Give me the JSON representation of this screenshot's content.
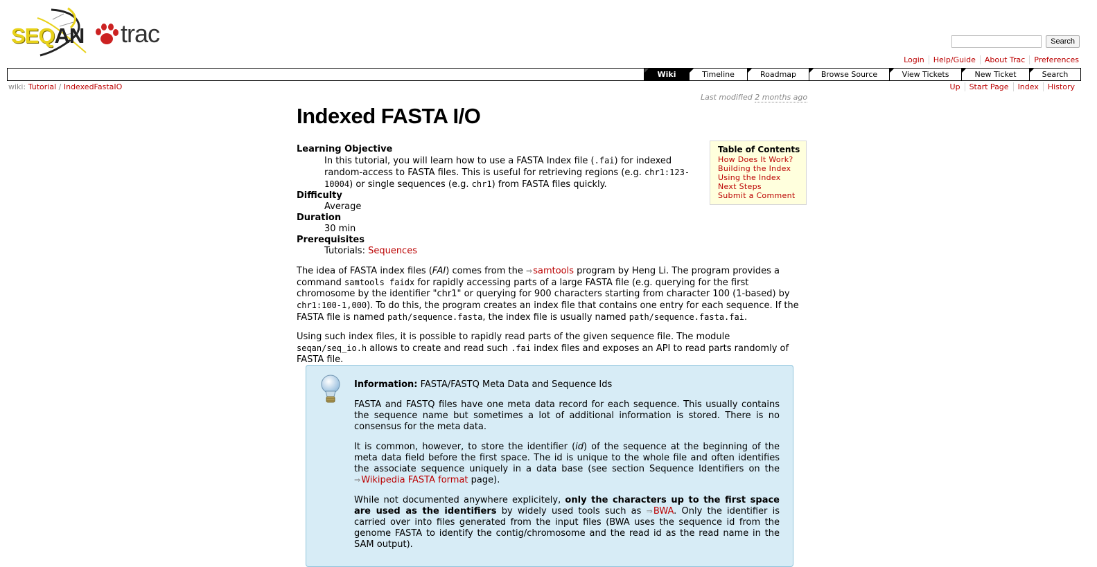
{
  "logo": {
    "seqan_a": "SEQ",
    "seqan_b": "AN",
    "trac": "trac"
  },
  "search": {
    "button": "Search",
    "placeholder": ""
  },
  "metanav": [
    "Login",
    "Help/Guide",
    "About Trac",
    "Preferences"
  ],
  "mainnav": [
    "Wiki",
    "Timeline",
    "Roadmap",
    "Browse Source",
    "View Tickets",
    "New Ticket",
    "Search"
  ],
  "breadcrumb": {
    "prefix": "wiki:",
    "parent": "Tutorial",
    "sep": "/",
    "page": "IndexedFastaIO"
  },
  "ctxtnav": [
    "Up",
    "Start Page",
    "Index",
    "History"
  ],
  "lastmod": {
    "prefix": "Last modified",
    "ago": "2 months ago"
  },
  "page": {
    "title": "Indexed FASTA I/O",
    "objective_label": "Learning Objective",
    "objective": {
      "t1": "In this tutorial, you will learn how to use a FASTA Index file (",
      "c1": ".fai",
      "t2": ") for indexed random-access to FASTA files. This is useful for retrieving regions (e.g. ",
      "c2": "chr1:123-10004",
      "t3": ") or single sequences (e.g. ",
      "c3": "chr1",
      "t4": ") from FASTA files quickly."
    },
    "difficulty_label": "Difficulty",
    "difficulty": "Average",
    "duration_label": "Duration",
    "duration": "30 min",
    "prereq_label": "Prerequisites",
    "prereq_text": "Tutorials: ",
    "prereq_link": "Sequences",
    "para1": {
      "t1": "The idea of FASTA index files (",
      "i1": "FAI",
      "t2": ") comes from the ",
      "link": "samtools",
      "t3": " program by Heng Li. The program provides a command ",
      "c1": "samtools faidx",
      "t4": " for rapidly accessing parts of a large FASTA file (e.g. querying for the first chromosome by the identifier \"chr1\" or querying for 900 characters starting from character 100 (1-based) by ",
      "c2": "chr1:100-1,000",
      "t5": "). To do this, the program creates an index file that contains one entry for each sequence. If the FASTA file is named ",
      "c3": "path/sequence.fasta",
      "t6": ", the index file is usually named ",
      "c4": "path/sequence.fasta.fai",
      "t7": "."
    },
    "para2": {
      "t1": "Using such index files, it is possible to rapidly read parts of the given sequence file. The module ",
      "c1": "seqan/seq_io.h",
      "t2": " allows to create and read such ",
      "c2": ".fai",
      "t3": " index files and exposes an API to read parts randomly of FASTA file."
    }
  },
  "toc": {
    "title": "Table of Contents",
    "items": [
      "How Does It Work?",
      "Building the Index",
      "Using the Index",
      "Next Steps",
      "Submit a Comment"
    ]
  },
  "info": {
    "label": "Information:",
    "title": "FASTA/FASTQ Meta Data and Sequence Ids",
    "p1": "FASTA and FASTQ files have one meta data record for each sequence. This usually contains the sequence name but sometimes a lot of additional information is stored. There is no consensus for the meta data.",
    "p2": {
      "t1": "It is common, however, to store the identifier (",
      "i1": "id",
      "t2": ") of the sequence at the beginning of the meta data field before the first space. The id is unique to the whole file and often identifies the associate sequence uniquely in a data base (see section Sequence Identifiers on the ",
      "link": "Wikipedia FASTA format",
      "t3": " page)."
    },
    "p3": {
      "t1": "While not documented anywhere explicitely, ",
      "b1": "only the characters up to the first space are used as the identifiers",
      "t2": " by widely used tools such as ",
      "link": "BWA",
      "t3": ". Only the identifier is carried over into files generated from the input files (BWA uses the sequence id from the genome FASTA to identify the contig/chromosome and the read id as the read name in the SAM output)."
    }
  },
  "colors": {
    "link": "#bb0000",
    "info_bg": "#d7ecf6",
    "toc_bg": "#ffffdd"
  }
}
